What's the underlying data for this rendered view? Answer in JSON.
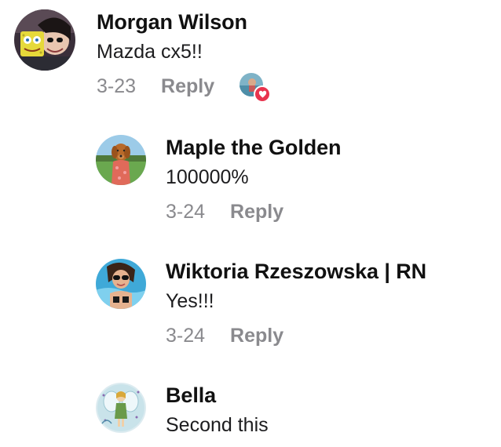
{
  "comments": [
    {
      "author": "Morgan Wilson",
      "text": "Mazda cx5!!",
      "date": "3-23",
      "reply_label": "Reply",
      "avatar_icon": "person-with-sponge-mask-avatar",
      "reaction": {
        "icon": "heart-icon",
        "color": "#e8344e"
      }
    },
    {
      "author": "Maple the Golden",
      "text": "100000%",
      "date": "3-24",
      "reply_label": "Reply",
      "avatar_icon": "golden-retriever-avatar"
    },
    {
      "author": "Wiktoria Rzeszowska | RN",
      "text": "Yes!!!",
      "date": "3-24",
      "reply_label": "Reply",
      "avatar_icon": "woman-sunglasses-pool-avatar"
    },
    {
      "author": "Bella",
      "text": "Second this",
      "avatar_icon": "fairy-illustration-avatar"
    }
  ],
  "colors": {
    "name": "#111111",
    "text": "#1c1c1e",
    "meta": "#8a8a8e",
    "heart": "#e8344e"
  }
}
